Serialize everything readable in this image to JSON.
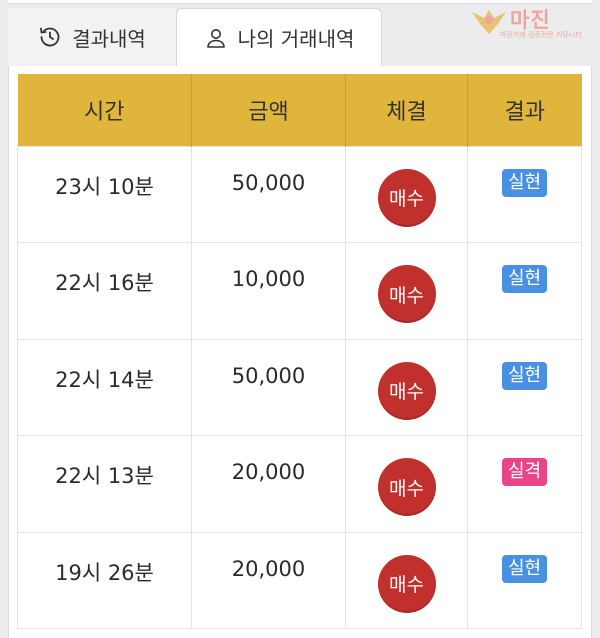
{
  "tabs": {
    "results_label": "결과내역",
    "my_trades_label": "나의 거래내역"
  },
  "logo": {
    "title": "마진",
    "subtitle": "마진거래 검증전문 커뮤니티"
  },
  "table": {
    "headers": [
      "시간",
      "금액",
      "체결",
      "결과"
    ],
    "rows": [
      {
        "time": "23시 10분",
        "amount": "50,000",
        "execution": "매수",
        "result": "실현",
        "result_color": "#4a90e2"
      },
      {
        "time": "22시 16분",
        "amount": "10,000",
        "execution": "매수",
        "result": "실현",
        "result_color": "#4a90e2"
      },
      {
        "time": "22시 14분",
        "amount": "50,000",
        "execution": "매수",
        "result": "실현",
        "result_color": "#4a90e2"
      },
      {
        "time": "22시 13분",
        "amount": "20,000",
        "execution": "매수",
        "result": "실격",
        "result_color": "#e8458b"
      },
      {
        "time": "19시 26분",
        "amount": "20,000",
        "execution": "매수",
        "result": "실현",
        "result_color": "#4a90e2"
      }
    ]
  },
  "colors": {
    "header_bg": "#e0b53c",
    "buy_button": "#c0302c",
    "badge_realized": "#4a90e2",
    "badge_disqualified": "#e8458b"
  },
  "icons": {
    "results_tab": "history-icon",
    "my_trades_tab": "user-icon"
  }
}
